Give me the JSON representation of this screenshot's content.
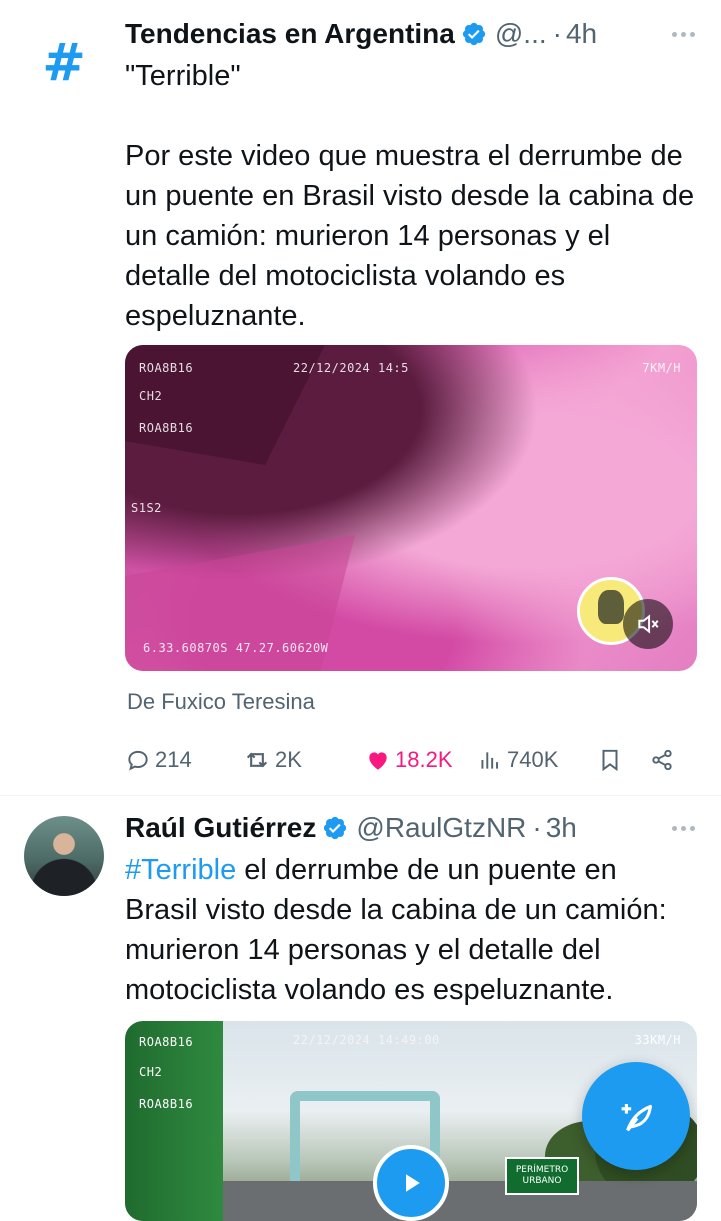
{
  "tweet1": {
    "avatar_glyph": "#",
    "name": "Tendencias en Argentina",
    "handle": "@...",
    "time": "4h",
    "text_quote": "\"Terrible\"",
    "text_body": "Por este video que muestra el derrumbe de un puente en Brasil visto desde la cabina de un camión: murieron 14 personas y el detalle del motociclista volando es espeluznante.",
    "video_overlay": {
      "top_left": "ROA8B16",
      "ch": "CH2",
      "id2": "ROA8B16",
      "timestamp": "22/12/2024 14:5",
      "speed": "7KM/H",
      "s1s2": "S1S2",
      "coords": "6.33.60870S 47.27.60620W"
    },
    "source": "De Fuxico Teresina",
    "actions": {
      "replies": "214",
      "reposts": "2K",
      "likes": "18.2K",
      "views": "740K"
    }
  },
  "tweet2": {
    "name": "Raúl Gutiérrez",
    "handle": "@RaulGtzNR",
    "time": "3h",
    "hashtag": "#Terrible",
    "text": " el derrumbe de un puente en Brasil visto desde la cabina de un camión: murieron 14 personas y el detalle del motociclista volando es espeluznante.",
    "video_overlay": {
      "top_left": "ROA8B16",
      "ch": "CH2",
      "id2": "ROA8B16",
      "timestamp": "22/12/2024 14:49:00",
      "speed": "33KM/H",
      "sign": "PERÍMETRO URBANO"
    }
  },
  "colors": {
    "accent": "#1d9bf0",
    "like": "#f91880",
    "muted": "#536471"
  }
}
